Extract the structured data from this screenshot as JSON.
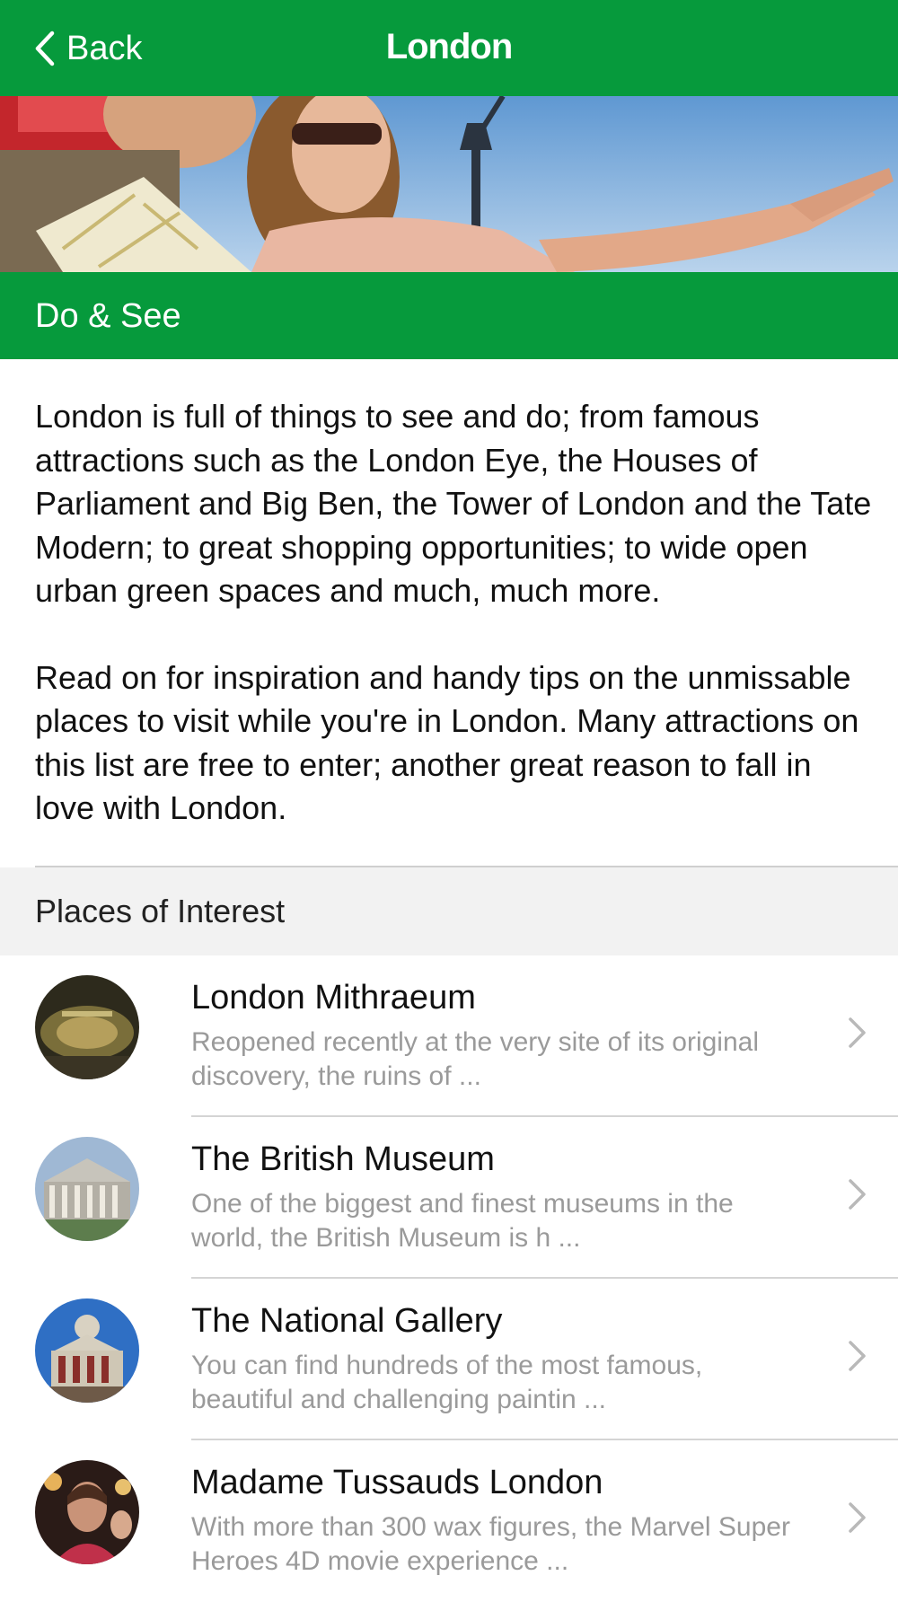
{
  "navbar": {
    "back_label": "Back",
    "title": "London",
    "color": "#069a3c"
  },
  "section": {
    "label": "Do & See"
  },
  "description": {
    "paragraph_1": "London is full of things to see and do; from famous attractions such as the London Eye, the Houses of Parliament and Big Ben, the Tower of London and the Tate Modern; to great shopping opportunities; to wide open urban green spaces and much, much more.",
    "paragraph_2": "Read on for inspiration and handy tips on the unmissable places to visit while you're in London. Many attractions on this list are free to enter; another great reason to fall in love with London."
  },
  "places": {
    "header": "Places of Interest",
    "items": [
      {
        "title": "London Mithraeum",
        "snippet": "Reopened recently at the very site of its original discovery, the ruins of ..."
      },
      {
        "title": "The British Museum",
        "snippet": "One of the biggest and finest museums in the world, the British Museum is h ..."
      },
      {
        "title": "The National Gallery",
        "snippet": "You can find hundreds of the most famous, beautiful and challenging paintin ..."
      },
      {
        "title": "Madame Tussauds London",
        "snippet": "With more than 300 wax figures, the Marvel Super Heroes 4D movie experience ..."
      }
    ]
  }
}
